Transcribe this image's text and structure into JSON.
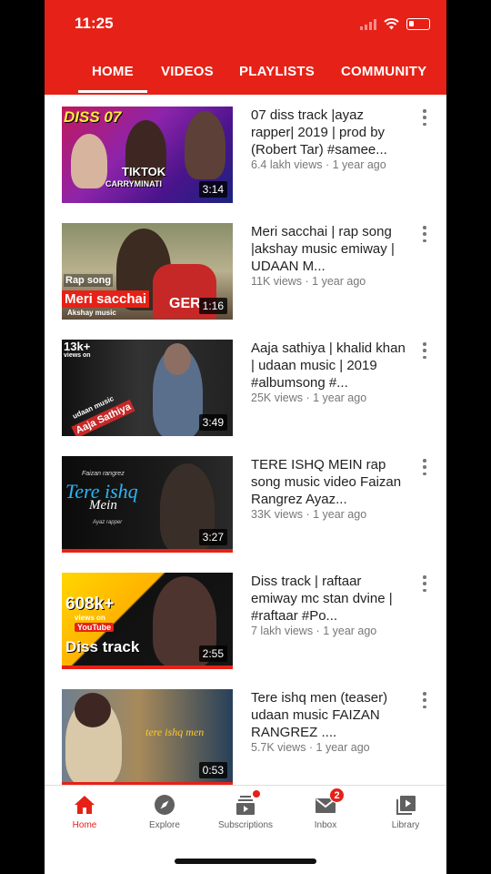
{
  "status": {
    "time": "11:25"
  },
  "tabs": [
    "HOME",
    "VIDEOS",
    "PLAYLISTS",
    "COMMUNITY"
  ],
  "colors": {
    "brand": "#e62117",
    "text": "#222222",
    "meta": "#777777"
  },
  "videos": [
    {
      "title": "07 diss track |ayaz rapper| 2019 | prod by (Robert Tar) #samee...",
      "meta": "6.4 lakh views · 1 year ago",
      "duration": "3:14",
      "thumb_text": [
        "DISS 07",
        "TIKTOK",
        "CARRYMINATI"
      ]
    },
    {
      "title": "Meri sacchai | rap song   |akshay music emiway  | UDAAN M...",
      "meta": "11K views · 1 year ago",
      "duration": "1:16",
      "thumb_text": [
        "Rap song",
        "Meri sacchai",
        "Akshay music",
        "GER"
      ]
    },
    {
      "title": "Aaja sathiya | khalid khan | udaan music | 2019 #albumsong #...",
      "meta": "25K views · 1 year ago",
      "duration": "3:49",
      "thumb_text": [
        "13k+",
        "views on",
        "udaan music",
        "Aaja Sathiya"
      ]
    },
    {
      "title": "TERE ISHQ MEIN  rap song music video Faizan Rangrez Ayaz...",
      "meta": "33K views · 1 year ago",
      "duration": "3:27",
      "thumb_text": [
        "Faizan rangrez",
        "Tere ishq",
        "Mein",
        "Ayaz rapper"
      ]
    },
    {
      "title": "Diss track | raftaar emiway mc stan dvine | #raftaar #Po...",
      "meta": "7 lakh views · 1 year ago",
      "duration": "2:55",
      "thumb_text": [
        "608k+",
        "views on",
        "YouTube",
        "Diss track"
      ]
    },
    {
      "title": "Tere ishq men (teaser) udaan music FAIZAN RANGREZ ....",
      "meta": "5.7K views · 1 year ago",
      "duration": "0:53",
      "thumb_text": [
        "tere ishq men"
      ]
    }
  ],
  "bottom_nav": [
    {
      "label": "Home",
      "icon": "home-icon",
      "active": true
    },
    {
      "label": "Explore",
      "icon": "compass-icon",
      "active": false
    },
    {
      "label": "Subscriptions",
      "icon": "subscriptions-icon",
      "active": false,
      "dot": true
    },
    {
      "label": "Inbox",
      "icon": "inbox-icon",
      "active": false,
      "badge": "2"
    },
    {
      "label": "Library",
      "icon": "library-icon",
      "active": false
    }
  ]
}
